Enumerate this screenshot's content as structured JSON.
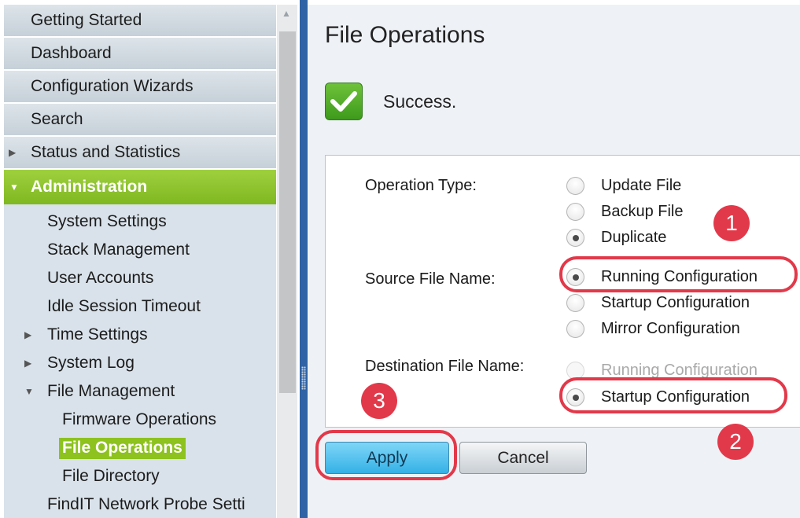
{
  "sidebar": {
    "top_items": [
      "Getting Started",
      "Dashboard",
      "Configuration Wizards",
      "Search"
    ],
    "status_item": "Status and Statistics",
    "active_item": "Administration",
    "sub_items": {
      "system_settings": "System Settings",
      "stack_management": "Stack Management",
      "user_accounts": "User Accounts",
      "idle_session_timeout": "Idle Session Timeout",
      "time_settings": "Time Settings",
      "system_log": "System Log",
      "file_management": "File Management",
      "firmware_operations": "Firmware Operations",
      "file_operations": "File Operations",
      "file_directory": "File Directory",
      "findit_probe": "FindIT Network Probe Setti"
    }
  },
  "main": {
    "title": "File Operations",
    "success_message": "Success.",
    "operation_type": {
      "label": "Operation Type:",
      "options": [
        "Update File",
        "Backup File",
        "Duplicate"
      ],
      "selected": "Duplicate"
    },
    "source_file": {
      "label": "Source File Name:",
      "options": [
        "Running Configuration",
        "Startup Configuration",
        "Mirror Configuration"
      ],
      "selected": "Running Configuration"
    },
    "destination_file": {
      "label": "Destination File Name:",
      "options": [
        "Running Configuration",
        "Startup Configuration"
      ],
      "disabled": "Running Configuration",
      "selected": "Startup Configuration"
    },
    "buttons": {
      "apply": "Apply",
      "cancel": "Cancel"
    }
  },
  "annotations": {
    "step1": "1",
    "step2": "2",
    "step3": "3"
  },
  "colors": {
    "accent_green": "#8dc21f",
    "splitter_blue": "#2f63a5",
    "annotation_red": "#e2394a",
    "apply_blue": "#34b1e6"
  },
  "icons": {
    "success": "checkmark-icon"
  }
}
